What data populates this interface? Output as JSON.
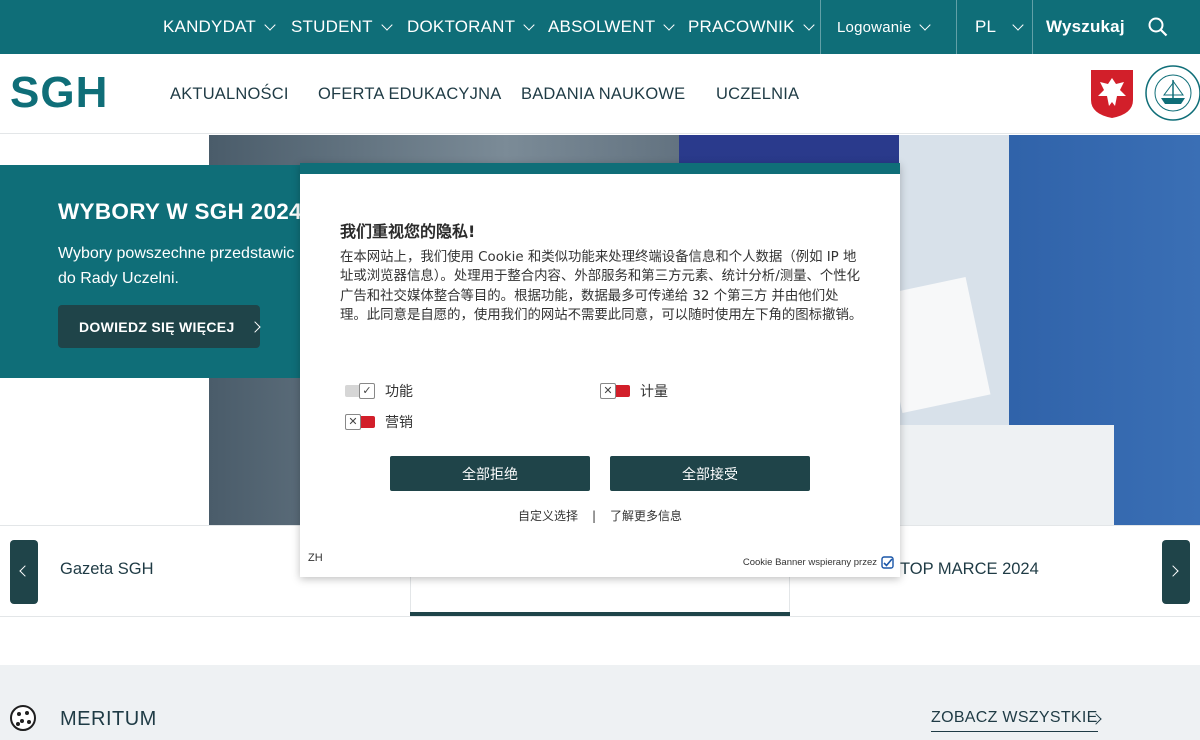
{
  "topbar": {
    "items": [
      "KANDYDAT",
      "STUDENT",
      "DOKTORANT",
      "ABSOLWENT",
      "PRACOWNIK"
    ],
    "login": "Logowanie",
    "lang": "PL",
    "search": "Wyszukaj",
    "bg_color": "#0f6e78"
  },
  "mainnav": {
    "logo": "SGH",
    "items": [
      "AKTUALNOŚCI",
      "OFERTA EDUKACYJNA",
      "BADANIA NAUKOWE",
      "UCZELNIA"
    ]
  },
  "hero": {
    "title": "WYBORY W SGH 2024",
    "text": "Wybory powszechne przedstawic",
    "text2": "do Rady Uczelni.",
    "button": "DOWIEDZ SIĘ WIĘCEJ"
  },
  "slider": {
    "left_label": "Gazeta SGH",
    "right_label": "TOP MARCE 2024"
  },
  "bottom": {
    "section_title": "MERITUM",
    "see_all": "ZOBACZ WSZYSTKIE"
  },
  "cookie": {
    "title": "我们重视您的隐私!",
    "body": "在本网站上，我们使用 Cookie 和类似功能来处理终端设备信息和个人数据（例如 IP 地址或浏览器信息）。处理用于整合内容、外部服务和第三方元素、统计分析/测量、个性化广告和社交媒体整合等目的。根据功能，数据最多可传递给 32 个第三方 并由他们处理。此同意是自愿的，使用我们的网站不需要此同意，可以随时使用左下角的图标撤销。",
    "options": [
      "功能",
      "计量",
      "营销"
    ],
    "reject_all": "全部拒绝",
    "accept_all": "全部接受",
    "customize": "自定义选择",
    "separator": "|",
    "learn_more": "了解更多信息",
    "lang": "ZH",
    "powered_by": "Cookie Banner wspierany przez"
  }
}
